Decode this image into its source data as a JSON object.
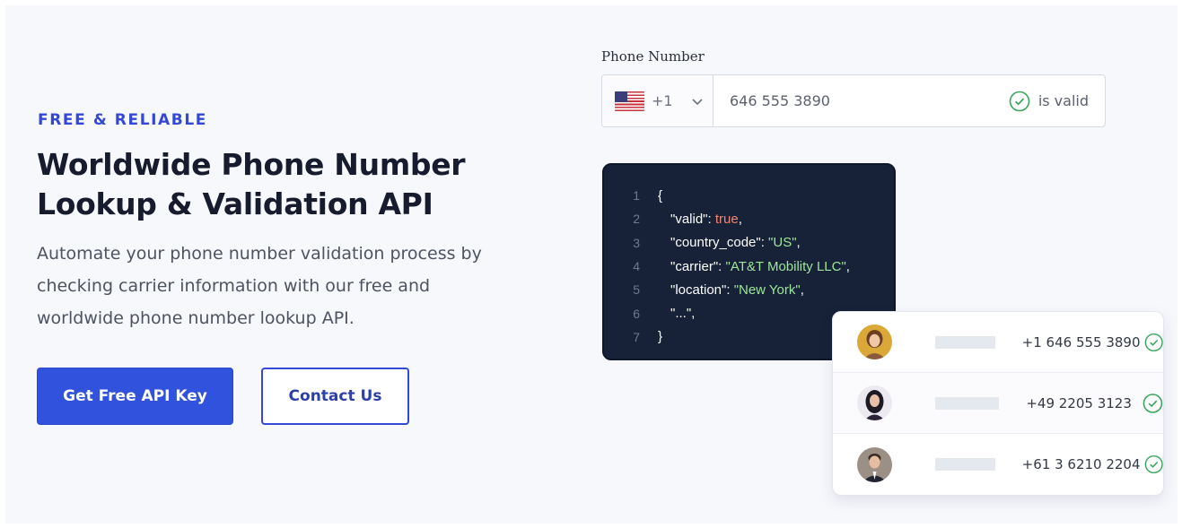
{
  "hero": {
    "eyebrow": "FREE & RELIABLE",
    "headline_line1": "Worldwide Phone Number",
    "headline_line2": "Lookup & Validation API",
    "subtext_line1": "Automate your phone number validation process by",
    "subtext_line2": "checking carrier information with our free and",
    "subtext_line3": "worldwide phone number lookup API.",
    "primary_button": "Get Free API Key",
    "secondary_button": "Contact Us"
  },
  "phone_form": {
    "label": "Phone Number",
    "country_flag_icon": "us-flag-icon",
    "dial_code": "+1",
    "value": "646 555 3890",
    "status": "is valid"
  },
  "code_sample": {
    "line_numbers": [
      "1",
      "2",
      "3",
      "4",
      "5",
      "6",
      "7"
    ],
    "open_brace": "{",
    "valid_key": "\"valid\": ",
    "valid_value": "true",
    "country_key": "\"country_code\": ",
    "country_value": "\"US\"",
    "carrier_key": "\"carrier\": ",
    "carrier_value": "\"AT&T Mobility LLC\"",
    "location_key": "\"location\": ",
    "location_value": "\"New York\"",
    "ellipsis": "\"...\",",
    "comma": ",",
    "close_brace": "}"
  },
  "results": [
    {
      "number": "+1 646 555 3890"
    },
    {
      "number": "+49 2205 3123"
    },
    {
      "number": "+61 3 6210 2204"
    }
  ],
  "colors": {
    "accent": "#3152dc",
    "valid_green": "#38a55a",
    "code_bg": "#172238"
  }
}
